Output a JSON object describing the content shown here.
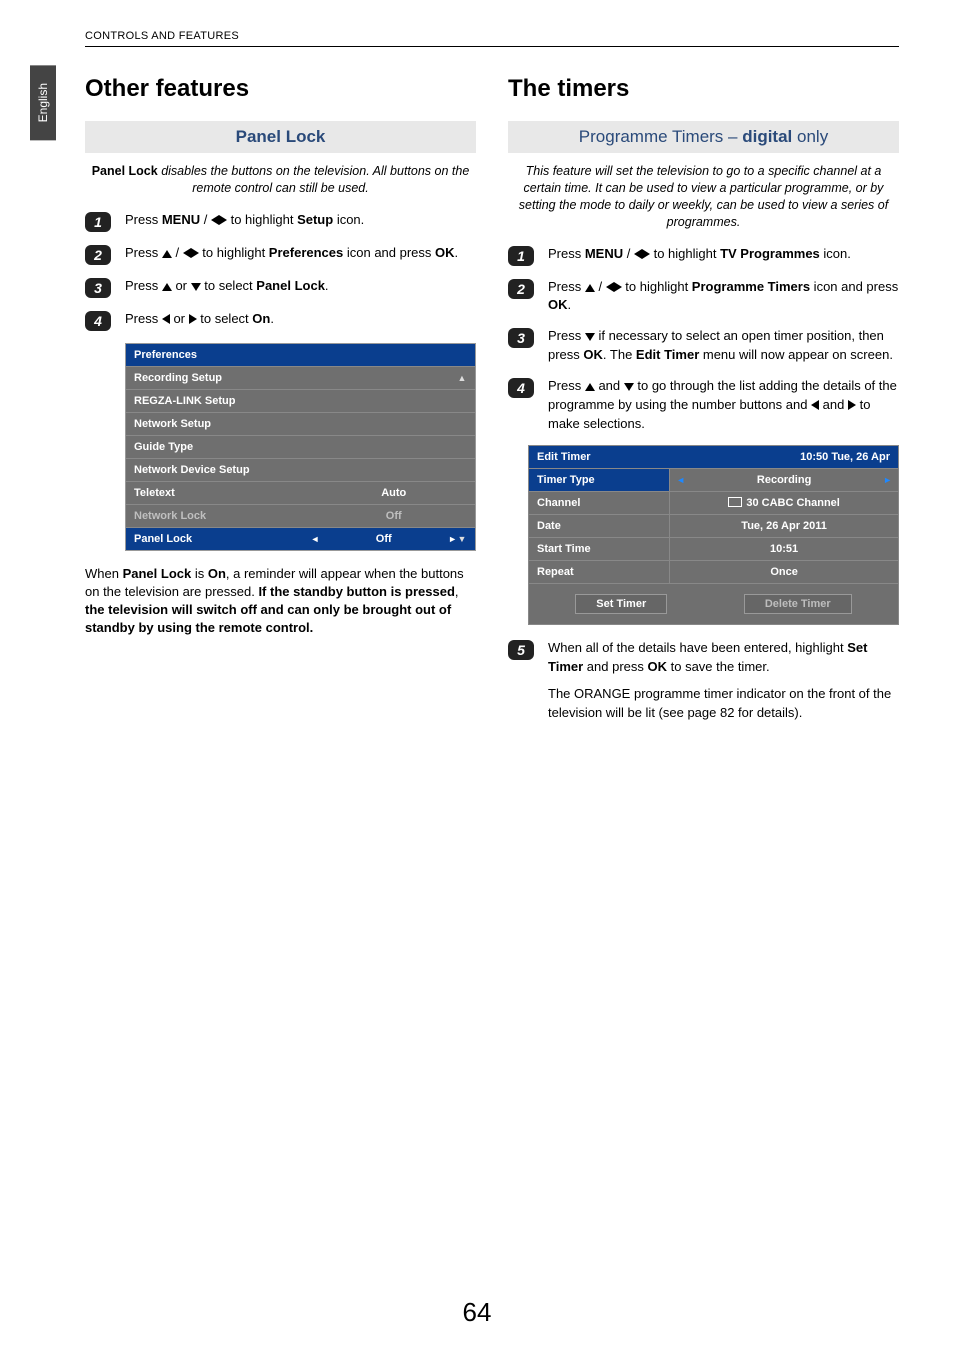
{
  "running_head": "CONTROLS AND FEATURES",
  "language_tab": "English",
  "page_number": "64",
  "left": {
    "title": "Other features",
    "subhead": "Panel Lock",
    "intro_lead_bold": "Panel Lock",
    "intro_rest": " disables the buttons on the television. All buttons on the remote control can still be used.",
    "steps": {
      "s1_a": "Press ",
      "s1_menu": "MENU",
      "s1_b": " / ",
      "s1_c": " to highlight ",
      "s1_setup": "Setup",
      "s1_d": " icon.",
      "s2_a": "Press ",
      "s2_b": " / ",
      "s2_c": " to highlight ",
      "s2_pref": "Preferences",
      "s2_d": " icon and press ",
      "s2_ok": "OK",
      "s2_e": ".",
      "s3_a": "Press ",
      "s3_b": " or ",
      "s3_c": " to select ",
      "s3_panel": "Panel Lock",
      "s3_d": ".",
      "s4_a": "Press ",
      "s4_b": " or ",
      "s4_c": " to select ",
      "s4_on": "On",
      "s4_d": "."
    },
    "osd": {
      "header": "Preferences",
      "rows": [
        {
          "label": "Recording Setup",
          "value": ""
        },
        {
          "label": "REGZA-LINK Setup",
          "value": ""
        },
        {
          "label": "Network Setup",
          "value": ""
        },
        {
          "label": "Guide Type",
          "value": ""
        },
        {
          "label": "Network Device Setup",
          "value": ""
        },
        {
          "label": "Teletext",
          "value": "Auto"
        },
        {
          "label": "Network Lock",
          "value": "Off",
          "dim": true
        },
        {
          "label": "Panel Lock",
          "value": "Off",
          "selected": true
        }
      ]
    },
    "note_a": "When ",
    "note_b": "Panel Lock",
    "note_c": " is ",
    "note_d": "On",
    "note_e": ", a reminder will appear when the buttons on the television are pressed. ",
    "note_bold": "If the standby button is pressed",
    "note_f": ", ",
    "note_bold2": "the television will switch off and can only be brought out of standby by using the remote control."
  },
  "right": {
    "title": "The timers",
    "subhead_a": "Programme Timers – ",
    "subhead_b": "digital",
    "subhead_c": " only",
    "intro": "This feature will set the television to go to a specific channel at a certain time. It can be used to view a particular programme, or by setting the mode to daily or weekly, can be used to view a series of programmes.",
    "steps": {
      "s1_a": "Press ",
      "s1_menu": "MENU",
      "s1_b": " / ",
      "s1_c": " to highlight ",
      "s1_tp": "TV Programmes",
      "s1_d": " icon.",
      "s2_a": "Press ",
      "s2_b": " / ",
      "s2_c": " to highlight ",
      "s2_pt": "Programme Timers",
      "s2_d": "  icon and press ",
      "s2_ok": "OK",
      "s2_e": ".",
      "s3_a": "Press ",
      "s3_b": " if necessary to select an open timer position, then press ",
      "s3_ok": "OK",
      "s3_c": ". The ",
      "s3_et": "Edit Timer",
      "s3_d": " menu will now appear on screen.",
      "s4_a": "Press ",
      "s4_b": " and ",
      "s4_c": " to go through the list adding the details of the programme by using the number buttons and ",
      "s4_d": " and ",
      "s4_e": " to make selections."
    },
    "osd": {
      "header_left": "Edit Timer",
      "header_right": "10:50 Tue, 26 Apr",
      "rows": [
        {
          "label": "Timer Type",
          "value": "Recording",
          "selected": true,
          "arrows": true
        },
        {
          "label": "Channel",
          "value": "30 CABC Channel",
          "tv": true
        },
        {
          "label": "Date",
          "value": "Tue, 26 Apr 2011"
        },
        {
          "label": "Start Time",
          "value": "10:51"
        },
        {
          "label": "Repeat",
          "value": "Once"
        }
      ],
      "btn_set": "Set Timer",
      "btn_delete": "Delete Timer"
    },
    "step5_a": "When all of the details have been entered, highlight ",
    "step5_b": "Set Timer",
    "step5_c": " and press ",
    "step5_ok": "OK",
    "step5_d": " to save the timer.",
    "step5_p2": "The ORANGE programme timer indicator on the front of the television will be lit (see page 82 for details)."
  }
}
